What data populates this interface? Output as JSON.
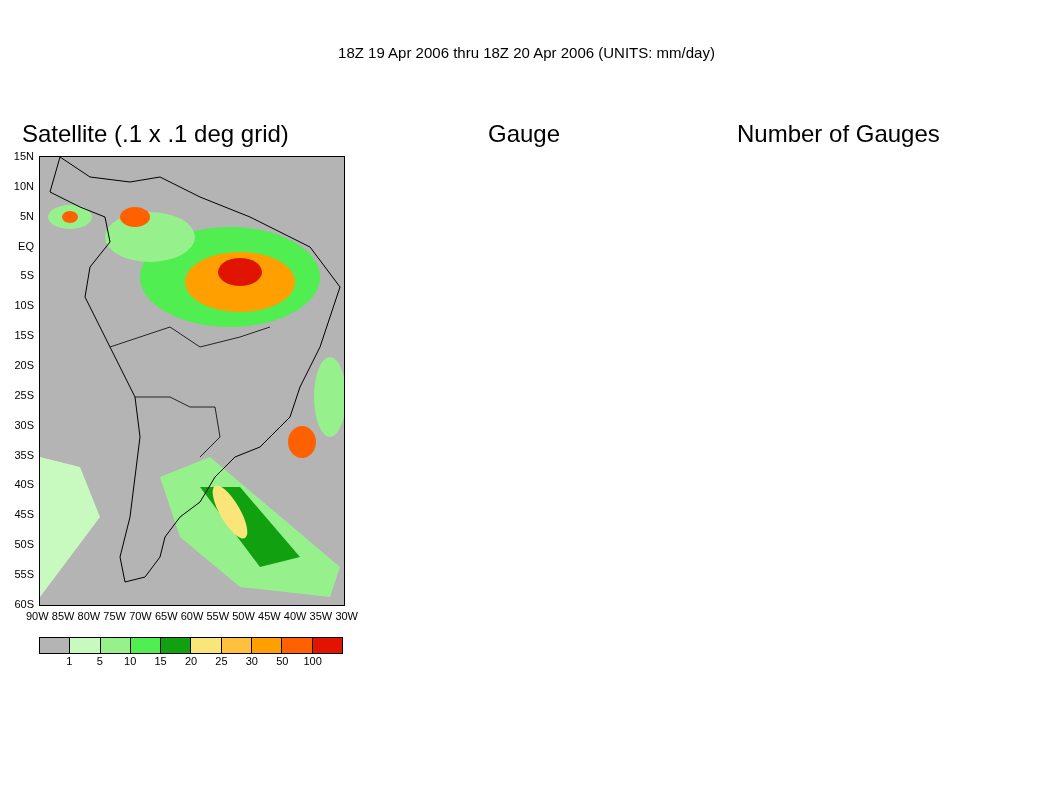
{
  "title": "18Z 19 Apr 2006 thru 18Z 20 Apr 2006 (UNITS: mm/day)",
  "panels": [
    {
      "title": "Satellite (.1 x .1 deg grid)"
    },
    {
      "title": "Gauge"
    },
    {
      "title": "Number of Gauges"
    }
  ],
  "map": {
    "lat_labels": [
      "15N",
      "10N",
      "5N",
      "EQ",
      "5S",
      "10S",
      "15S",
      "20S",
      "25S",
      "30S",
      "35S",
      "40S",
      "45S",
      "50S",
      "55S",
      "60S"
    ],
    "lon_labels": [
      "90W",
      "85W",
      "80W",
      "75W",
      "70W",
      "65W",
      "60W",
      "55W",
      "50W",
      "45W",
      "40W",
      "35W",
      "30W"
    ]
  },
  "legend": {
    "bins": [
      {
        "color": "#b4b4b4"
      },
      {
        "color": "#c8fac0"
      },
      {
        "color": "#96f08c"
      },
      {
        "color": "#50ee50"
      },
      {
        "color": "#10a010"
      },
      {
        "color": "#fae678"
      },
      {
        "color": "#ffc03c"
      },
      {
        "color": "#ffa000"
      },
      {
        "color": "#ff6000"
      },
      {
        "color": "#e01400"
      }
    ],
    "labels": [
      "1",
      "5",
      "10",
      "15",
      "20",
      "25",
      "30",
      "50",
      "100"
    ]
  }
}
